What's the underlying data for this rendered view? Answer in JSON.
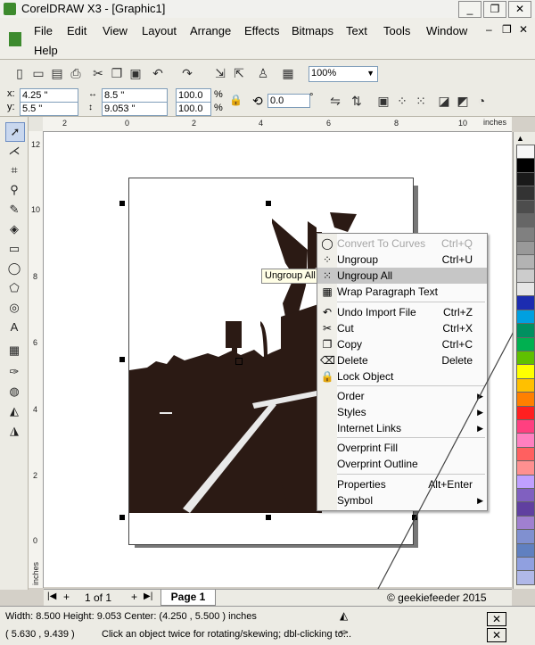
{
  "window": {
    "title": "CorelDRAW X3 - [Graphic1]",
    "controls": [
      "_",
      "❐",
      "✕"
    ],
    "doc_controls": [
      "–",
      "❐",
      "✕"
    ]
  },
  "menu": [
    "File",
    "Edit",
    "View",
    "Layout",
    "Arrange",
    "Effects",
    "Bitmaps",
    "Text",
    "Tools",
    "Window",
    "Help"
  ],
  "toolbar": {
    "zoom": "100%"
  },
  "propbar": {
    "x_label": "x:",
    "x": "4.25 \"",
    "y_label": "y:",
    "y": "5.5 \"",
    "width": "8.5 \"",
    "height": "9.053 \"",
    "scale_x": "100.0",
    "scale_y": "100.0",
    "pct": "%",
    "rotation": "0.0",
    "deg": "°"
  },
  "ruler": {
    "unit": "inches",
    "h_ticks": [
      "2",
      "0",
      "2",
      "4",
      "6",
      "8",
      "10"
    ],
    "v_ticks": [
      "12",
      "10",
      "8",
      "6",
      "4",
      "2",
      "0"
    ],
    "v_unit": "inches"
  },
  "tooltip": "Ungroup All",
  "context_menu": [
    {
      "label": "Convert To Curves",
      "shortcut": "Ctrl+Q",
      "icon": "convert-curves-icon",
      "glyph": "◯",
      "disabled": true
    },
    {
      "label": "Ungroup",
      "shortcut": "Ctrl+U",
      "icon": "ungroup-icon",
      "glyph": "⁘"
    },
    {
      "label": "Ungroup All",
      "shortcut": "",
      "icon": "ungroup-all-icon",
      "glyph": "⁙",
      "highlight": true
    },
    {
      "label": "Wrap Paragraph Text",
      "shortcut": "",
      "icon": "wrap-text-icon",
      "glyph": "▦",
      "sep_after": true
    },
    {
      "label": "Undo Import File",
      "shortcut": "Ctrl+Z",
      "icon": "undo-icon",
      "glyph": "↶"
    },
    {
      "label": "Cut",
      "shortcut": "Ctrl+X",
      "icon": "scissors-icon",
      "glyph": "✂"
    },
    {
      "label": "Copy",
      "shortcut": "Ctrl+C",
      "icon": "copy-icon",
      "glyph": "❐"
    },
    {
      "label": "Delete",
      "shortcut": "Delete",
      "icon": "delete-icon",
      "glyph": "⌫"
    },
    {
      "label": "Lock Object",
      "shortcut": "",
      "icon": "lock-icon",
      "glyph": "🔒",
      "sep_after": true
    },
    {
      "label": "Order",
      "shortcut": "",
      "submenu": true
    },
    {
      "label": "Styles",
      "shortcut": "",
      "submenu": true
    },
    {
      "label": "Internet Links",
      "shortcut": "",
      "submenu": true,
      "sep_after": true
    },
    {
      "label": "Overprint Fill",
      "shortcut": ""
    },
    {
      "label": "Overprint Outline",
      "shortcut": "",
      "sep_after": true
    },
    {
      "label": "Properties",
      "shortcut": "Alt+Enter"
    },
    {
      "label": "Symbol",
      "shortcut": "",
      "submenu": true
    }
  ],
  "page_nav": {
    "page_count": "1 of 1",
    "tab": "Page 1"
  },
  "watermark": "© geekiefeeder 2015",
  "status": {
    "dimensions": "Width: 8.500  Height: 9.053  Center: (4.250 , 5.500 )  inches",
    "coords": "( 5.630 , 9.439 )",
    "hint": "Click an object twice for rotating/skewing; dbl-clicking to..."
  },
  "palette": [
    "#f7f7f7",
    "#000000",
    "#1a1a1a",
    "#333333",
    "#4d4d4d",
    "#666666",
    "#808080",
    "#999999",
    "#b3b3b3",
    "#cccccc",
    "#e6e6e6",
    "#1c2cb0",
    "#00a0e0",
    "#009060",
    "#00b050",
    "#60c000",
    "#ffff00",
    "#ffc000",
    "#ff8000",
    "#ff2020",
    "#ff4080",
    "#ff80c0",
    "#ff6060",
    "#ff9090",
    "#c0a0ff",
    "#8060c0",
    "#6040a0",
    "#a080d0",
    "#8090d0",
    "#6080c0",
    "#90a0e0",
    "#b0b8e8"
  ]
}
